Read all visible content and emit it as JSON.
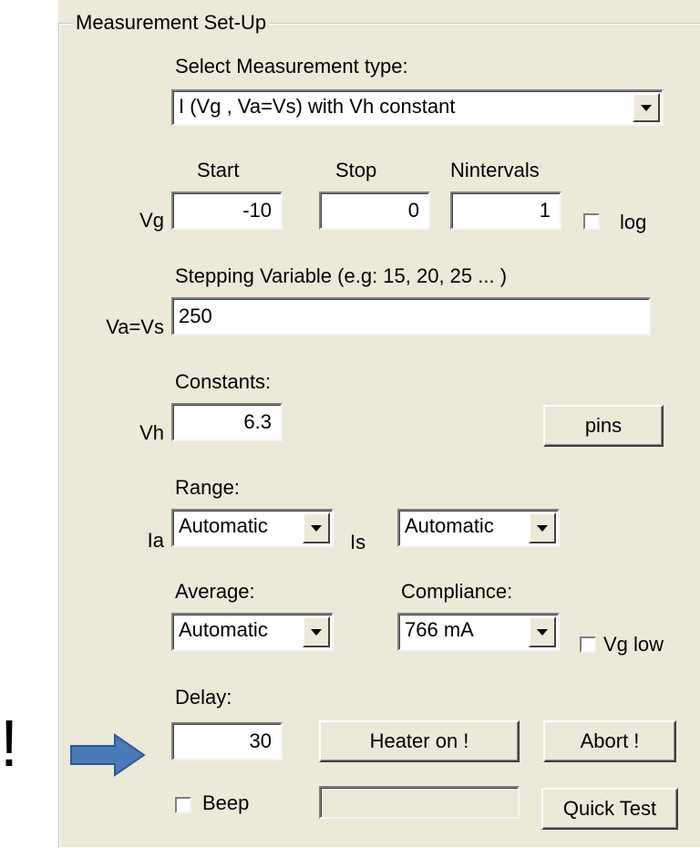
{
  "groupbox": {
    "title": "Measurement Set-Up"
  },
  "measurement": {
    "select_label": "Select Measurement type:",
    "type_value": "I (Vg , Va=Vs) with Vh constant"
  },
  "sweep": {
    "col_start": "Start",
    "col_stop": "Stop",
    "col_nintervals": "Nintervals",
    "row_label": "Vg",
    "start": "-10",
    "stop": "0",
    "nintervals": "1",
    "log_label": "log",
    "log_checked": false
  },
  "stepping": {
    "label": "Stepping Variable (e.g: 15, 20, 25 ... )",
    "row_label": "Va=Vs",
    "value": "250"
  },
  "constants": {
    "label": "Constants:",
    "row_label": "Vh",
    "vh": "6.3",
    "pins_button": "pins"
  },
  "range": {
    "label": "Range:",
    "ia_label": "Ia",
    "ia_value": "Automatic",
    "is_label": "Is",
    "is_value": "Automatic"
  },
  "average": {
    "label": "Average:",
    "value": "Automatic"
  },
  "compliance": {
    "label": "Compliance:",
    "value": "766 mA",
    "vg_low_label": "Vg low",
    "vg_low_checked": false
  },
  "delay": {
    "label": "Delay:",
    "value": "30",
    "heater_button": "Heater on !",
    "abort_button": "Abort !"
  },
  "footer": {
    "beep_label": "Beep",
    "beep_checked": false,
    "quick_test_button": "Quick Test"
  },
  "annotation": {
    "exclamation": "!",
    "arrow_color": "#4a7ab8",
    "arrow_icon": "right-arrow-icon"
  }
}
